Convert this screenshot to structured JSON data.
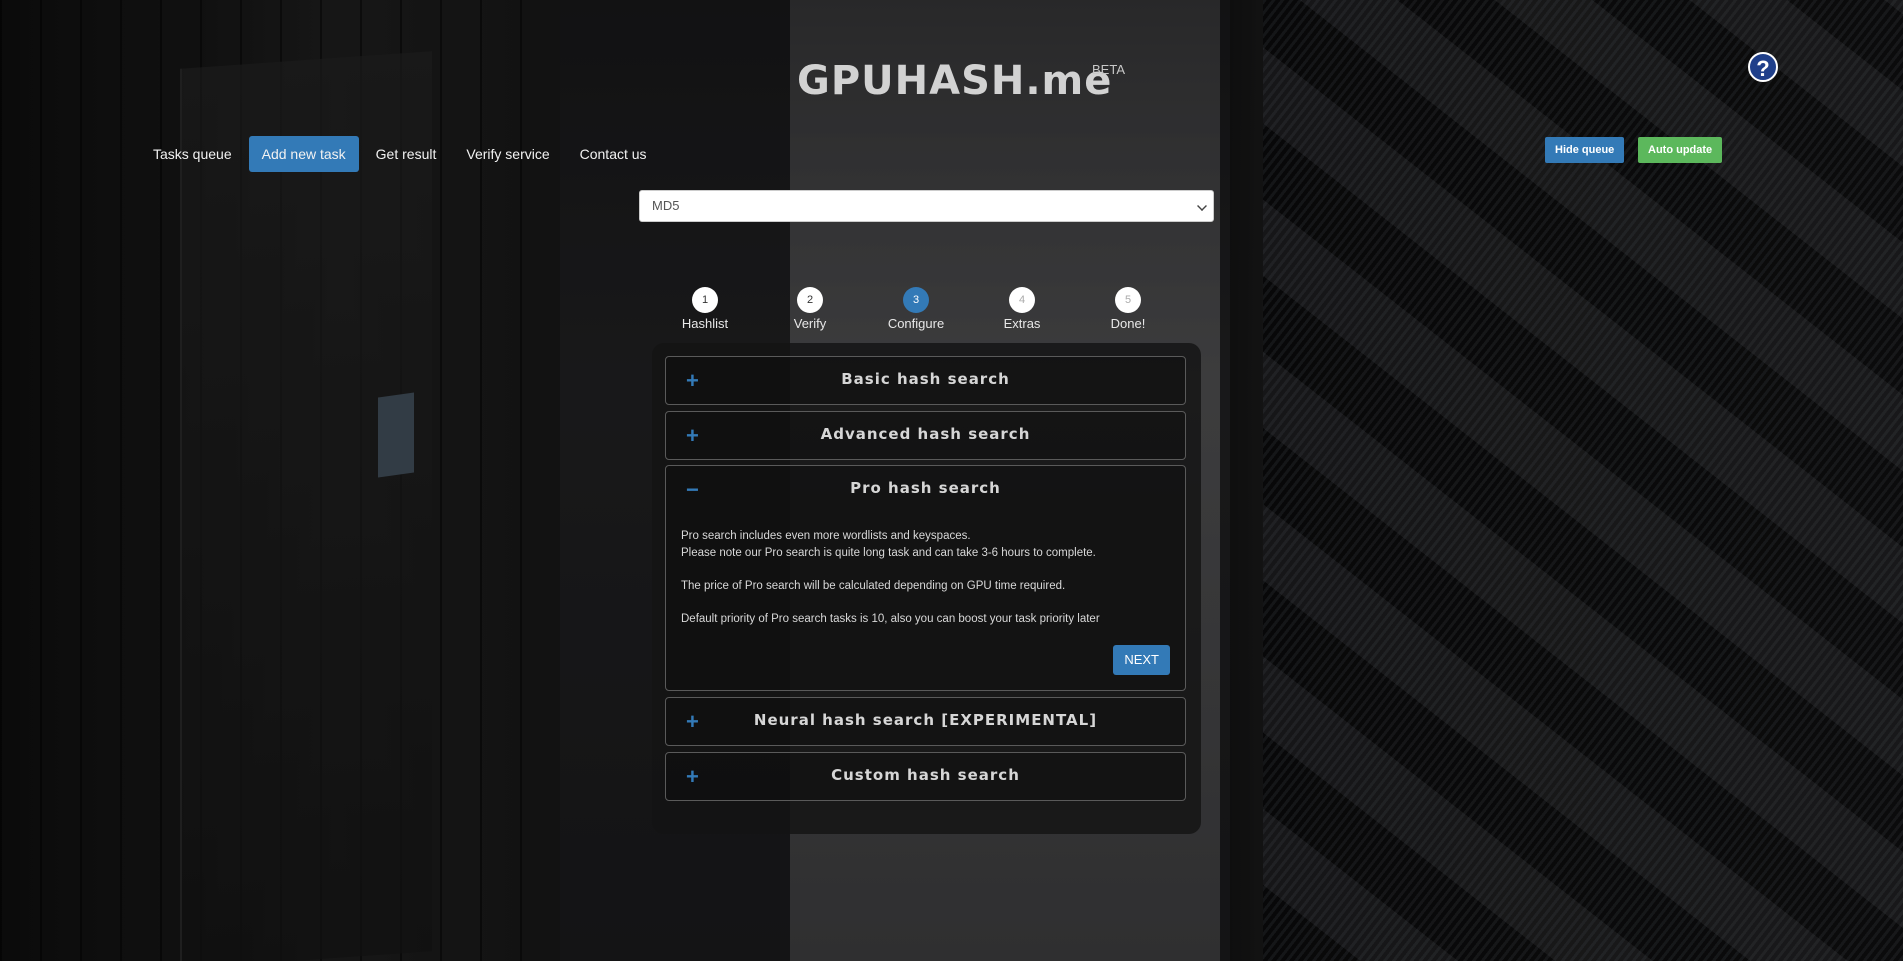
{
  "brand": {
    "title": "GPUHASH.me",
    "badge": "BETA"
  },
  "help": {
    "icon": "help-icon",
    "glyph": "?"
  },
  "nav": {
    "items": [
      {
        "label": "Tasks queue",
        "active": false
      },
      {
        "label": "Add new task",
        "active": true
      },
      {
        "label": "Get result",
        "active": false
      },
      {
        "label": "Verify service",
        "active": false
      },
      {
        "label": "Contact us",
        "active": false
      }
    ]
  },
  "queue_controls": {
    "hide_queue": "Hide queue",
    "auto_update": "Auto update"
  },
  "hash_type": {
    "selected": "MD5"
  },
  "steps": [
    {
      "num": "1",
      "label": "Hashlist"
    },
    {
      "num": "2",
      "label": "Verify"
    },
    {
      "num": "3",
      "label": "Configure"
    },
    {
      "num": "4",
      "label": "Extras"
    },
    {
      "num": "5",
      "label": "Done!"
    }
  ],
  "accordion": {
    "basic": {
      "sign": "+",
      "title": "Basic hash search"
    },
    "advanced": {
      "sign": "+",
      "title": "Advanced hash search"
    },
    "pro": {
      "sign": "−",
      "title": "Pro hash search",
      "line1": "Pro search includes even more wordlists and keyspaces.",
      "line2": "Please note our Pro search is quite long task and can take 3-6 hours to complete.",
      "line3": "The price of Pro search will be calculated depending on GPU time required.",
      "line4": "Default priority of Pro search tasks is 10, also you can boost your task priority later",
      "next": "NEXT"
    },
    "neural": {
      "sign": "+",
      "title": "Neural hash search [EXPERIMENTAL]"
    },
    "custom": {
      "sign": "+",
      "title": "Custom hash search"
    }
  },
  "colors": {
    "primary": "#337ab7",
    "success": "#5cb85c"
  }
}
